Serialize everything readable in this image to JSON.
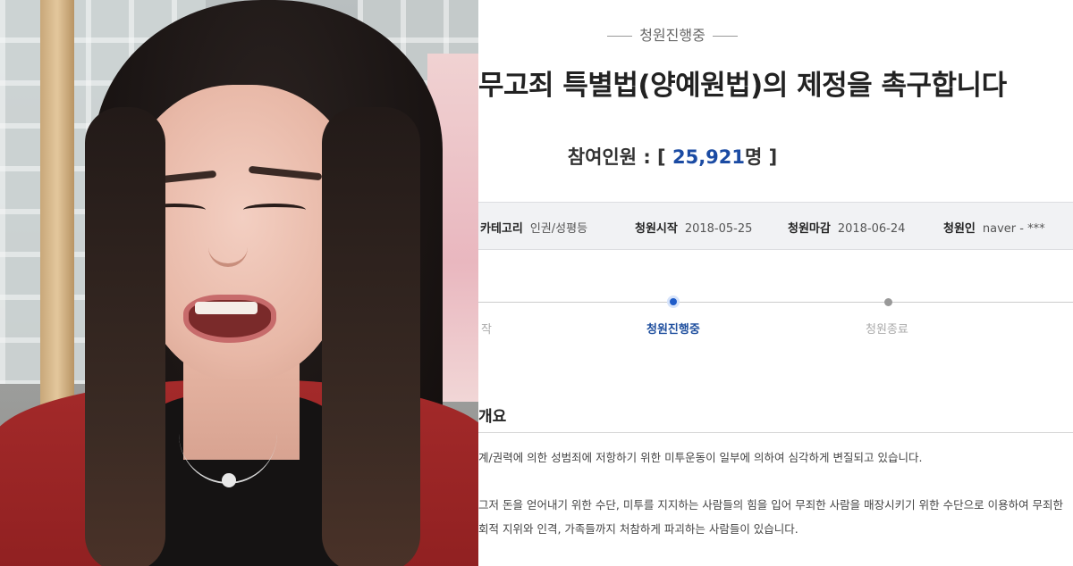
{
  "petition": {
    "status_badge": "청원진행중",
    "title": "무고죄 특별법(양예원법)의 제정을 촉구합니다",
    "participants": {
      "label": "참여인원 : [ ",
      "count": "25,921",
      "unit": "명 ]"
    },
    "meta": {
      "category_label": "카테고리",
      "category_value": "인권/성평등",
      "start_label": "청원시작",
      "start_value": "2018-05-25",
      "end_label": "청원마감",
      "end_value": "2018-06-24",
      "author_label": "청원인",
      "author_value": "naver - ***"
    },
    "progress": {
      "prev_label": "작",
      "current_label": "청원진행중",
      "next_label": "청원종료"
    },
    "section_title": "개요",
    "body_lines": [
      "계/권력에 의한 성범죄에 저항하기 위한 미투운동이 일부에 의하여 심각하게 변질되고 있습니다.",
      "그저 돈을 얻어내기 위한 수단, 미투를 지지하는 사람들의 힘을 입어 무죄한 사람을 매장시키기 위한 수단으로 이용하여 무죄한",
      "회적 지위와 인격, 가족들까지 처참하게 파괴하는 사람들이 있습니다."
    ]
  },
  "colors": {
    "accent_blue": "#1f5cc9",
    "count_blue": "#1b4ba3",
    "sweater_red": "#a42a2a"
  }
}
